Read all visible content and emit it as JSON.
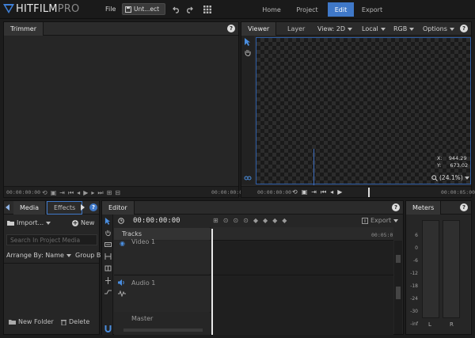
{
  "app": {
    "brand": "HITFILM",
    "edition": "PRO"
  },
  "menu": {
    "file": "File"
  },
  "project": {
    "name": "Unt...ect"
  },
  "nav_tabs": [
    {
      "label": "Home",
      "active": false
    },
    {
      "label": "Project",
      "active": false
    },
    {
      "label": "Edit",
      "active": true
    },
    {
      "label": "Export",
      "active": false
    }
  ],
  "trimmer": {
    "tab": "Trimmer",
    "timecode_left": "00:00:00:00",
    "timecode_right": "00:00:00:00"
  },
  "viewer": {
    "tabs": [
      "Viewer",
      "Layer"
    ],
    "view_mode": "View: 2D",
    "space": "Local",
    "channel": "RGB",
    "options": "Options",
    "coord_x_label": "X:",
    "coord_x": "944.29",
    "coord_y_label": "Y:",
    "coord_y": "673.02",
    "zoom": "(24.1%)",
    "timecode_left": "00:00:00:00",
    "timecode_right": "00:00:05:00"
  },
  "media": {
    "tabs": [
      "Media",
      "Effects"
    ],
    "import_label": "Import...",
    "new_label": "New",
    "search_placeholder": "Search In Project Media",
    "arrange_label": "Arrange By: Name",
    "group_label": "Group B",
    "new_folder_label": "New Folder",
    "delete_label": "Delete"
  },
  "editor": {
    "tab": "Editor",
    "timecode": "00:00:00:00",
    "export_label": "Export",
    "tracks_label": "Tracks",
    "ruler_time": "00:05:0",
    "video_track": "Video 1",
    "audio_track": "Audio 1",
    "master_track": "Master"
  },
  "meters": {
    "tab": "Meters",
    "scale": [
      "6",
      "0",
      "-6",
      "-12",
      "-18",
      "-24",
      "-30",
      "-inf"
    ],
    "channels": [
      "L",
      "R"
    ]
  },
  "colors": {
    "accent": "#3f78c8",
    "panel": "#262626",
    "background": "#1c1c1c"
  }
}
